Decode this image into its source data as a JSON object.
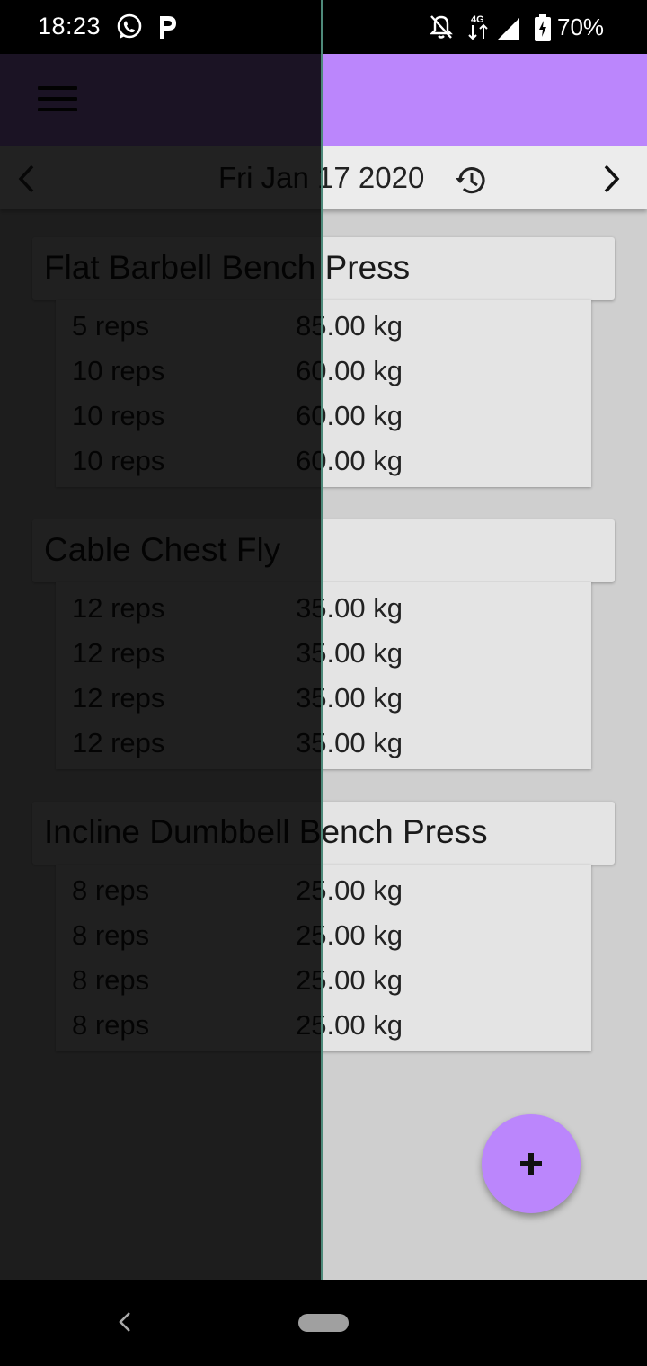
{
  "status_bar": {
    "time": "18:23",
    "battery": "70%",
    "network_label": "4G",
    "icons": [
      "whatsapp-icon",
      "p-icon",
      "bell-off-icon",
      "network-arrows-icon",
      "signal-icon",
      "battery-icon"
    ]
  },
  "app_bar": {
    "menu_icon": "menu-icon",
    "accent_color": "#bb86fc"
  },
  "date_nav": {
    "date": "Fri Jan 17 2020",
    "prev_icon": "chevron-left-icon",
    "next_icon": "chevron-right-icon",
    "history_icon": "history-icon"
  },
  "exercises": [
    {
      "name": "Flat Barbell Bench Press",
      "sets": [
        {
          "reps": "5 reps",
          "weight": "85.00 kg"
        },
        {
          "reps": "10 reps",
          "weight": "60.00 kg"
        },
        {
          "reps": "10 reps",
          "weight": "60.00 kg"
        },
        {
          "reps": "10 reps",
          "weight": "60.00 kg"
        }
      ]
    },
    {
      "name": "Cable Chest Fly",
      "sets": [
        {
          "reps": "12 reps",
          "weight": "35.00 kg"
        },
        {
          "reps": "12 reps",
          "weight": "35.00 kg"
        },
        {
          "reps": "12 reps",
          "weight": "35.00 kg"
        },
        {
          "reps": "12 reps",
          "weight": "35.00 kg"
        }
      ]
    },
    {
      "name": "Incline Dumbbell Bench Press",
      "sets": [
        {
          "reps": "8 reps",
          "weight": "25.00 kg"
        },
        {
          "reps": "8 reps",
          "weight": "25.00 kg"
        },
        {
          "reps": "8 reps",
          "weight": "25.00 kg"
        },
        {
          "reps": "8 reps",
          "weight": "25.00 kg"
        }
      ]
    }
  ],
  "fab": {
    "icon": "plus-icon",
    "color": "#bb86fc"
  },
  "nav_bar": {
    "back_icon": "back-icon",
    "home_icon": "home-pill"
  }
}
